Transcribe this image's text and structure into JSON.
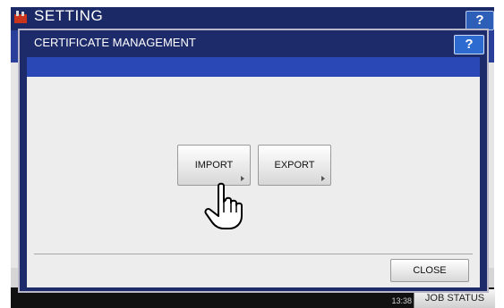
{
  "background": {
    "title": "SETTING",
    "help_label": "?",
    "datetime": "13:38",
    "job_status_label": "JOB STATUS"
  },
  "dialog": {
    "title": "CERTIFICATE MANAGEMENT",
    "help_label": "?",
    "buttons": {
      "import_label": "IMPORT",
      "export_label": "EXPORT",
      "close_label": "CLOSE"
    }
  },
  "icons": [
    "setting-icon",
    "hand-pointer-icon"
  ],
  "colors": {
    "title_bar": "#1d2b6b",
    "accent_bar": "#2b48b7",
    "help_button": "#2e6bd0",
    "body_bg": "#ededed"
  }
}
